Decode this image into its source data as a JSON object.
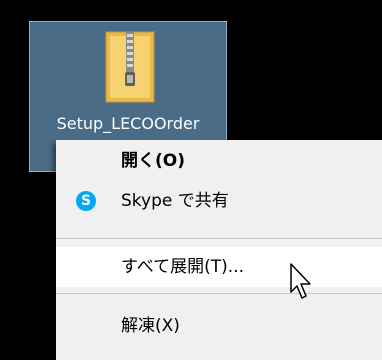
{
  "desktop": {
    "file_label": "Setup_LECOOrder",
    "file_icon": "zip-folder-icon"
  },
  "context_menu": {
    "items": [
      {
        "label": "開く(O)",
        "icon": ""
      },
      {
        "label": "Skype で共有",
        "icon": "skype-icon"
      },
      {
        "label": "すべて展開(T)...",
        "icon": ""
      },
      {
        "label": "解凍(X)",
        "icon": ""
      }
    ]
  },
  "skype_glyph": "S",
  "colors": {
    "desktop_bg": "#000000",
    "selection_bg": "#4a6c86",
    "menu_bg": "#f0f0f0",
    "menu_hover": "#ffffff",
    "skype_blue": "#00a9f0"
  }
}
